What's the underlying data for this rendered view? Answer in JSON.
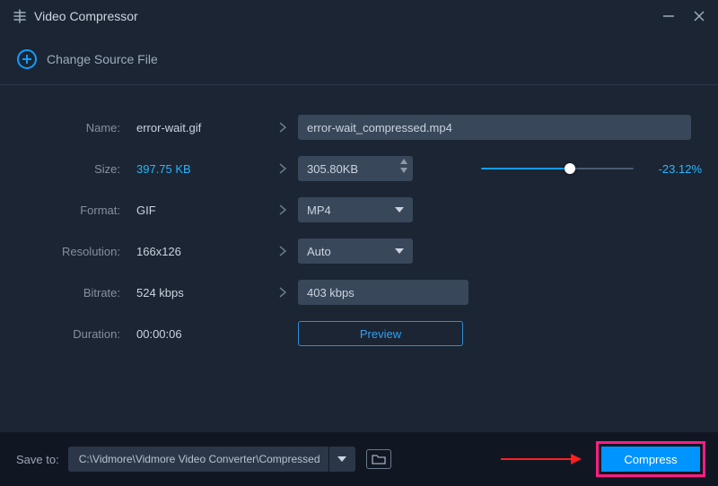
{
  "titlebar": {
    "title": "Video Compressor"
  },
  "source": {
    "change_label": "Change Source File"
  },
  "fields": {
    "name": {
      "label": "Name:",
      "source": "error-wait.gif",
      "target": "error-wait_compressed.mp4"
    },
    "size": {
      "label": "Size:",
      "source": "397.75 KB",
      "target": "305.80KB",
      "percent": "-23.12%",
      "slider_pct": 58
    },
    "format": {
      "label": "Format:",
      "source": "GIF",
      "target": "MP4"
    },
    "resolution": {
      "label": "Resolution:",
      "source": "166x126",
      "target": "Auto"
    },
    "bitrate": {
      "label": "Bitrate:",
      "source": "524 kbps",
      "target": "403 kbps"
    },
    "duration": {
      "label": "Duration:",
      "source": "00:00:06"
    }
  },
  "buttons": {
    "preview": "Preview",
    "compress": "Compress"
  },
  "footer": {
    "saveto_label": "Save to:",
    "path": "C:\\Vidmore\\Vidmore Video Converter\\Compressed"
  },
  "colors": {
    "accent": "#109dff",
    "annotate": "#ff1d86"
  }
}
